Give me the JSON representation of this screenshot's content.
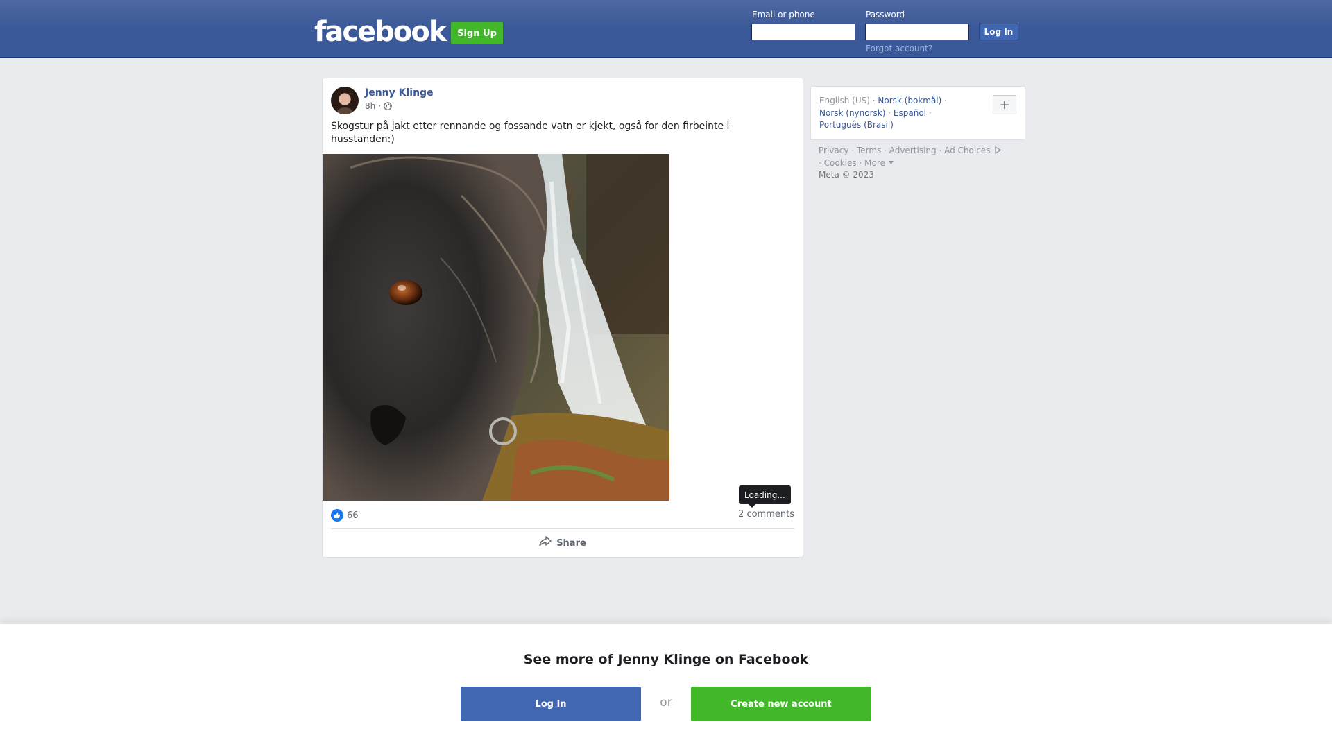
{
  "header": {
    "logo_text": "facebook",
    "signup_label": "Sign Up",
    "email_label": "Email or phone",
    "email_value": "",
    "password_label": "Password",
    "password_value": "",
    "login_label": "Log In",
    "forgot_label": "Forgot account?"
  },
  "post": {
    "author": "Jenny Klinge",
    "time": "8h",
    "separator": "·",
    "privacy_icon": "globe-icon",
    "text": "Skogstur på jakt etter rennande og fossande vatn er kjekt, også for den firbeinte i husstanden:)",
    "photo_icon": "dog-waterfall-photo",
    "reaction_icon": "like-icon",
    "reaction_count": "66",
    "comments_label": "2 comments",
    "tooltip": "Loading...",
    "share_label": "Share"
  },
  "languages": {
    "current": "English (US)",
    "items": [
      "Norsk (bokmål)",
      "Norsk (nynorsk)",
      "Español",
      "Português (Brasil)"
    ],
    "sep": "·",
    "add_label": "+"
  },
  "footer": {
    "links": [
      "Privacy",
      "Terms",
      "Advertising",
      "Ad Choices",
      "Cookies",
      "More"
    ],
    "sep": "·",
    "copyright": "Meta © 2023"
  },
  "banner": {
    "title": "See more of Jenny Klinge on Facebook",
    "login_label": "Log In",
    "or_label": "or",
    "create_label": "Create new account"
  },
  "colors": {
    "brand_blue": "#3b5998",
    "button_blue": "#4267b2",
    "green": "#42b72a",
    "link": "#385898"
  }
}
